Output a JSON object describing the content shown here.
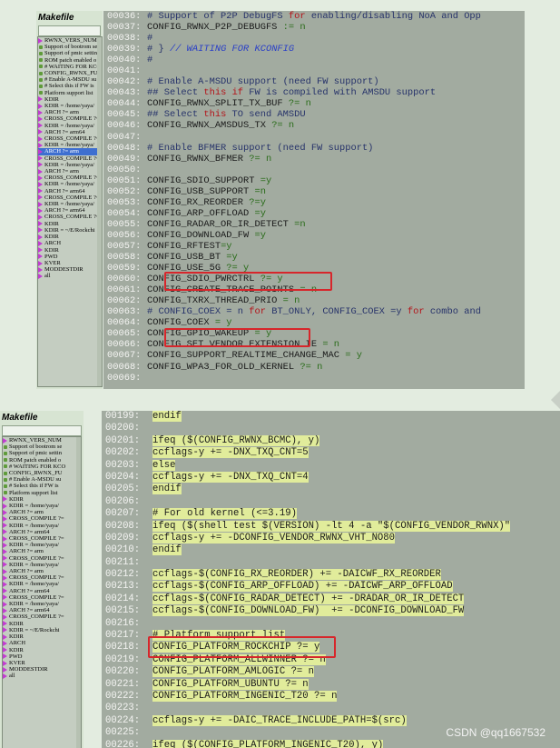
{
  "top": {
    "sidebar": {
      "title": "Makefile",
      "items": [
        {
          "t": "RWNX_VERS_NUM",
          "l": 0
        },
        {
          "t": "Support of bootrom se",
          "l": 1
        },
        {
          "t": "Support of pmic settin",
          "l": 1
        },
        {
          "t": "ROM patch enabled o",
          "l": 1
        },
        {
          "t": "# WAITING FOR KCO",
          "l": 1
        },
        {
          "t": "CONFIG_RWNX_FU",
          "l": 1
        },
        {
          "t": "# Enable A-MSDU su",
          "l": 1
        },
        {
          "t": "# Select this if FW is",
          "l": 1
        },
        {
          "t": "Platform support list",
          "l": 1
        },
        {
          "t": "KDIR",
          "l": 0
        },
        {
          "t": "KDIR  = /home/yaya/",
          "l": 0
        },
        {
          "t": "ARCH ?= arm",
          "l": 0
        },
        {
          "t": "CROSS_COMPILE ?=",
          "l": 0
        },
        {
          "t": "KDIR  = /home/yaya/",
          "l": 0
        },
        {
          "t": "ARCH ?= arm64",
          "l": 0
        },
        {
          "t": "CROSS_COMPILE ?=",
          "l": 0
        },
        {
          "t": "KDIR  = /home/yaya/",
          "l": 0
        },
        {
          "t": "ARCH ?= arm",
          "l": 0,
          "sel": true
        },
        {
          "t": "CROSS_COMPILE ?=",
          "l": 0
        },
        {
          "t": "KDIR  = /home/yaya/",
          "l": 0
        },
        {
          "t": "ARCH ?= arm",
          "l": 0
        },
        {
          "t": "CROSS_COMPILE ?=",
          "l": 0
        },
        {
          "t": "KDIR  = /home/yaya/",
          "l": 0
        },
        {
          "t": "ARCH ?= arm64",
          "l": 0
        },
        {
          "t": "CROSS_COMPILE ?=",
          "l": 0
        },
        {
          "t": "KDIR  = /home/yaya/",
          "l": 0
        },
        {
          "t": "ARCH ?= arm64",
          "l": 0
        },
        {
          "t": "CROSS_COMPILE ?=",
          "l": 0
        },
        {
          "t": "KDIR",
          "l": 0
        },
        {
          "t": "KDIR  = ~/E/Rockchi",
          "l": 0
        },
        {
          "t": "KDIR",
          "l": 0
        },
        {
          "t": "ARCH",
          "l": 0
        },
        {
          "t": "KDIR",
          "l": 0
        },
        {
          "t": "PWD",
          "l": 0
        },
        {
          "t": "KVER",
          "l": 0
        },
        {
          "t": "MODDESTDIR",
          "l": 0
        },
        {
          "t": "all",
          "l": 0
        }
      ]
    },
    "lines": [
      {
        "n": "00036:",
        "t": "# Support of P2P DebugFS for enabling/disabling NoA and Opp"
      },
      {
        "n": "00037:",
        "t": "CONFIG_RWNX_P2P_DEBUGFS := n"
      },
      {
        "n": "00038:",
        "t": "#"
      },
      {
        "n": "00039:",
        "t": "# } // WAITING FOR KCONFIG"
      },
      {
        "n": "00040:",
        "t": "#"
      },
      {
        "n": "00041:",
        "t": ""
      },
      {
        "n": "00042:",
        "t": "# Enable A-MSDU support (need FW support)"
      },
      {
        "n": "00043:",
        "t": "## Select this if FW is compiled with AMSDU support"
      },
      {
        "n": "00044:",
        "t": "CONFIG_RWNX_SPLIT_TX_BUF ?= n"
      },
      {
        "n": "00045:",
        "t": "## Select this TO send AMSDU"
      },
      {
        "n": "00046:",
        "t": "CONFIG_RWNX_AMSDUS_TX ?= n"
      },
      {
        "n": "00047:",
        "t": ""
      },
      {
        "n": "00048:",
        "t": "# Enable BFMER support (need FW support)"
      },
      {
        "n": "00049:",
        "t": "CONFIG_RWNX_BFMER ?= n"
      },
      {
        "n": "00050:",
        "t": ""
      },
      {
        "n": "00051:",
        "t": "CONFIG_SDIO_SUPPORT =y"
      },
      {
        "n": "00052:",
        "t": "CONFIG_USB_SUPPORT =n"
      },
      {
        "n": "00053:",
        "t": "CONFIG_RX_REORDER ?=y"
      },
      {
        "n": "00054:",
        "t": "CONFIG_ARP_OFFLOAD =y"
      },
      {
        "n": "00055:",
        "t": "CONFIG_RADAR_OR_IR_DETECT =n"
      },
      {
        "n": "00056:",
        "t": "CONFIG_DOWNLOAD_FW =y"
      },
      {
        "n": "00057:",
        "t": "CONFIG_RFTEST=y"
      },
      {
        "n": "00058:",
        "t": "CONFIG_USB_BT =y"
      },
      {
        "n": "00059:",
        "t": "CONFIG_USE_5G ?= y"
      },
      {
        "n": "00060:",
        "t": "CONFIG_SDIO_PWRCTRL ?= y"
      },
      {
        "n": "00061:",
        "t": "CONFIG_CREATE_TRACE_POINTS = n"
      },
      {
        "n": "00062:",
        "t": "CONFIG_TXRX_THREAD_PRIO = n"
      },
      {
        "n": "00063:",
        "t": "# CONFIG_COEX = n for BT_ONLY, CONFIG_COEX =y for combo and"
      },
      {
        "n": "00064:",
        "t": "CONFIG_COEX = y"
      },
      {
        "n": "00065:",
        "t": "CONFIG_GPIO_WAKEUP = y"
      },
      {
        "n": "00066:",
        "t": "CONFIG_SET_VENDOR_EXTENSION_IE = n"
      },
      {
        "n": "00067:",
        "t": "CONFIG_SUPPORT_REALTIME_CHANGE_MAC = y"
      },
      {
        "n": "00068:",
        "t": "CONFIG_WPA3_FOR_OLD_KERNEL ?= n"
      },
      {
        "n": "00069:",
        "t": ""
      }
    ]
  },
  "bottom": {
    "sidebar": {
      "title": "Makefile",
      "items": [
        {
          "t": "RWNX_VERS_NUM",
          "l": 0
        },
        {
          "t": "Support of bootrom se",
          "l": 1
        },
        {
          "t": "Support of pmic settin",
          "l": 1
        },
        {
          "t": "ROM patch enabled o",
          "l": 1
        },
        {
          "t": "# WAITING FOR KCO",
          "l": 1
        },
        {
          "t": "CONFIG_RWNX_FU",
          "l": 1
        },
        {
          "t": "# Enable A-MSDU su",
          "l": 1
        },
        {
          "t": "# Select this if FW is",
          "l": 1
        },
        {
          "t": "Platform support list",
          "l": 1
        },
        {
          "t": "KDIR",
          "l": 0
        },
        {
          "t": "KDIR  = /home/yaya/",
          "l": 0
        },
        {
          "t": "ARCH ?= arm",
          "l": 0
        },
        {
          "t": "CROSS_COMPILE ?=",
          "l": 0
        },
        {
          "t": "KDIR  = /home/yaya/",
          "l": 0
        },
        {
          "t": "ARCH ?= arm64",
          "l": 0
        },
        {
          "t": "CROSS_COMPILE ?=",
          "l": 0
        },
        {
          "t": "KDIR  = /home/yaya/",
          "l": 0
        },
        {
          "t": "ARCH ?= arm",
          "l": 0
        },
        {
          "t": "CROSS_COMPILE ?=",
          "l": 0
        },
        {
          "t": "KDIR  = /home/yaya/",
          "l": 0
        },
        {
          "t": "ARCH ?= arm",
          "l": 0
        },
        {
          "t": "CROSS_COMPILE ?=",
          "l": 0
        },
        {
          "t": "KDIR  = /home/yaya/",
          "l": 0
        },
        {
          "t": "ARCH ?= arm64",
          "l": 0
        },
        {
          "t": "CROSS_COMPILE ?=",
          "l": 0
        },
        {
          "t": "KDIR  = /home/yaya/",
          "l": 0
        },
        {
          "t": "ARCH ?= arm64",
          "l": 0
        },
        {
          "t": "CROSS_COMPILE ?=",
          "l": 0
        },
        {
          "t": "KDIR",
          "l": 0
        },
        {
          "t": "KDIR  = ~/E/Rockchi",
          "l": 0
        },
        {
          "t": "KDIR",
          "l": 0
        },
        {
          "t": "ARCH",
          "l": 0
        },
        {
          "t": "KDIR",
          "l": 0
        },
        {
          "t": "PWD",
          "l": 0
        },
        {
          "t": "KVER",
          "l": 0
        },
        {
          "t": "MODDESTDIR",
          "l": 0
        },
        {
          "t": "all",
          "l": 0
        }
      ]
    },
    "lines": [
      {
        "n": "00199:",
        "t": "endif",
        "hl": true
      },
      {
        "n": "00200:",
        "t": ""
      },
      {
        "n": "00201:",
        "t": "ifeq ($(CONFIG_RWNX_BCMC), y)",
        "hl": true
      },
      {
        "n": "00202:",
        "t": "ccflags-y += -DNX_TXQ_CNT=5",
        "hl": true
      },
      {
        "n": "00203:",
        "t": "else",
        "hl": true
      },
      {
        "n": "00204:",
        "t": "ccflags-y += -DNX_TXQ_CNT=4",
        "hl": true
      },
      {
        "n": "00205:",
        "t": "endif",
        "hl": true
      },
      {
        "n": "00206:",
        "t": ""
      },
      {
        "n": "00207:",
        "t": "# For old kernel (<=3.19)",
        "hl": true
      },
      {
        "n": "00208:",
        "t": "ifeq ($(shell test $(VERSION) -lt 4 -a \"$(CONFIG_VENDOR_RWNX)\"",
        "hl": true
      },
      {
        "n": "00209:",
        "t": "ccflags-y += -DCONFIG_VENDOR_RWNX_VHT_NO80",
        "hl": true
      },
      {
        "n": "00210:",
        "t": "endif",
        "hl": true
      },
      {
        "n": "00211:",
        "t": ""
      },
      {
        "n": "00212:",
        "t": "ccflags-$(CONFIG_RX_REORDER) += -DAICWF_RX_REORDER",
        "hl": true
      },
      {
        "n": "00213:",
        "t": "ccflags-$(CONFIG_ARP_OFFLOAD) += -DAICWF_ARP_OFFLOAD",
        "hl": true
      },
      {
        "n": "00214:",
        "t": "ccflags-$(CONFIG_RADAR_DETECT) += -DRADAR_OR_IR_DETECT",
        "hl": true
      },
      {
        "n": "00215:",
        "t": "ccflags-$(CONFIG_DOWNLOAD_FW)  += -DCONFIG_DOWNLOAD_FW",
        "hl": true
      },
      {
        "n": "00216:",
        "t": ""
      },
      {
        "n": "00217:",
        "t": "# Platform support list",
        "hl": true
      },
      {
        "n": "00218:",
        "t": "CONFIG_PLATFORM_ROCKCHIP ?= y",
        "hl": true
      },
      {
        "n": "00219:",
        "t": "CONFIG_PLATFORM_ALLWINNER ?= n",
        "hl": true
      },
      {
        "n": "00220:",
        "t": "CONFIG_PLATFORM_AMLOGIC ?= n",
        "hl": true
      },
      {
        "n": "00221:",
        "t": "CONFIG_PLATFORM_UBUNTU ?= n",
        "hl": true
      },
      {
        "n": "00222:",
        "t": "CONFIG_PLATFORM_INGENIC_T20 ?= n",
        "hl": true
      },
      {
        "n": "00223:",
        "t": ""
      },
      {
        "n": "00224:",
        "t": "ccflags-y += -DAIC_TRACE_INCLUDE_PATH=$(src)",
        "hl": true
      },
      {
        "n": "00225:",
        "t": ""
      },
      {
        "n": "00226:",
        "t": "ifeq ($(CONFIG_PLATFORM_INGENIC_T20), y)",
        "hl": true
      }
    ],
    "watermark": "CSDN @qq1667532"
  },
  "colors": {
    "highlight_box": "#d7262b",
    "line_highlight": "#e1ec9b",
    "editor_bg": "#a2aba0"
  }
}
